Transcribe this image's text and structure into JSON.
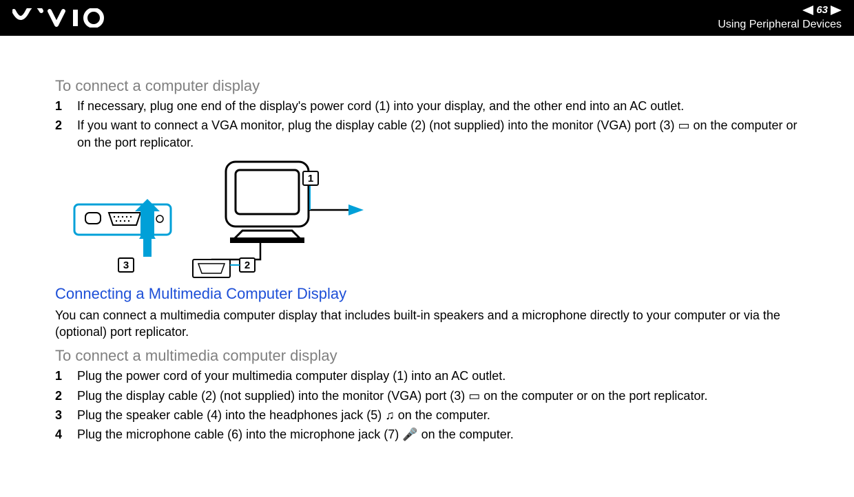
{
  "topbar": {
    "page_number": "63",
    "section": "Using Peripheral Devices"
  },
  "section1": {
    "heading": "To connect a computer display",
    "steps": [
      "If necessary, plug one end of the display's power cord (1) into your display, and the other end into an AC outlet.",
      "If you want to connect a VGA monitor, plug the display cable (2) (not supplied) into the monitor (VGA) port (3) ▭ on the computer or on the port replicator."
    ]
  },
  "section2": {
    "heading": "Connecting a Multimedia Computer Display",
    "intro": "You can connect a multimedia computer display that includes built-in speakers and a microphone directly to your computer or via the (optional) port replicator."
  },
  "section3": {
    "heading": "To connect a multimedia computer display",
    "steps": [
      "Plug the power cord of your multimedia computer display (1) into an AC outlet.",
      "Plug the display cable (2) (not supplied) into the monitor (VGA) port (3) ▭ on the computer or on the port replicator.",
      "Plug the speaker cable (4) into the headphones jack (5) ♫ on the computer.",
      "Plug the microphone cable (6) into the microphone jack (7) 🎤 on the computer."
    ]
  },
  "diagram": {
    "callouts": [
      "1",
      "2",
      "3"
    ]
  }
}
